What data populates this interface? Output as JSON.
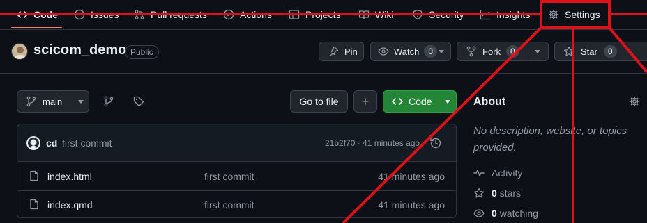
{
  "nav": {
    "tabs": [
      {
        "label": "Code",
        "icon": "code-icon"
      },
      {
        "label": "Issues",
        "icon": "issue-icon"
      },
      {
        "label": "Pull requests",
        "icon": "pull-request-icon"
      },
      {
        "label": "Actions",
        "icon": "play-icon"
      },
      {
        "label": "Projects",
        "icon": "table-icon"
      },
      {
        "label": "Wiki",
        "icon": "book-icon"
      },
      {
        "label": "Security",
        "icon": "shield-icon"
      },
      {
        "label": "Insights",
        "icon": "graph-icon"
      },
      {
        "label": "Settings",
        "icon": "gear-icon"
      }
    ]
  },
  "repo": {
    "name": "scicom_demo",
    "visibility": "Public",
    "pin_label": "Pin",
    "watch_label": "Watch",
    "watch_count": "0",
    "fork_label": "Fork",
    "fork_count": "0",
    "star_label": "Star",
    "star_count": "0"
  },
  "toolbar": {
    "branch": "main",
    "go_to_file": "Go to file",
    "add": "+",
    "code_label": "Code"
  },
  "commit": {
    "author": "cd",
    "message": "first commit",
    "meta": "21b2f70 · 41 minutes ago"
  },
  "files": [
    {
      "name": "index.html",
      "message": "first commit",
      "time": "41 minutes ago"
    },
    {
      "name": "index.qmd",
      "message": "first commit",
      "time": "41 minutes ago"
    }
  ],
  "about": {
    "title": "About",
    "description": "No description, website, or topics provided.",
    "activity": "Activity",
    "stars_count": "0",
    "stars_label": "stars",
    "watching_count": "0",
    "watching_label": "watching"
  },
  "colors": {
    "background": "#0d1117",
    "code_button": "#238636",
    "annotation": "#e0101a",
    "tab_underline": "#f78166"
  }
}
